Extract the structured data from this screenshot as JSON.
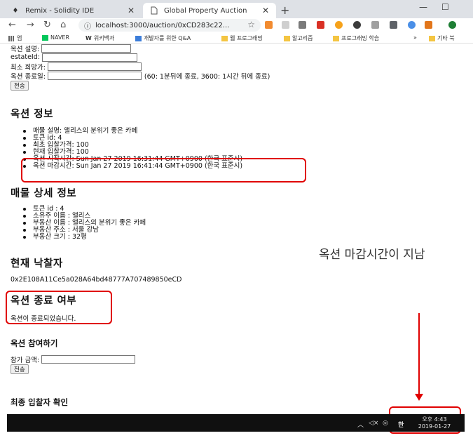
{
  "browser": {
    "tabs": [
      {
        "title": "Remix - Solidity IDE",
        "active": false
      },
      {
        "title": "Global Property Auction",
        "active": true
      }
    ],
    "address": {
      "url": "localhost:3000/auction/0xCD283c22..."
    },
    "bookmarks": [
      "앱",
      "NAVER",
      "위키백과",
      "개발자를 위한 Q&A",
      "웹 프로그래밍",
      "알고리즘",
      "프로그래밍 학습",
      "»",
      "기타 북"
    ],
    "colors": {
      "tabbar": "#dee1e6",
      "naver": "#03c75a"
    }
  },
  "form": {
    "description_label": "옥션 설명:",
    "estate_label": "estateId:",
    "min_price_label": "최소 희망가:",
    "end_label": "옥션 종료일:",
    "end_hint": "(60: 1분뒤에 종료, 3600: 1시간 뒤에 종료)",
    "submit": "전송"
  },
  "auction_info": {
    "heading": "옥션 정보",
    "items": [
      "매물 설명: 앨리스의 분위기 좋은 카페",
      "토큰 id: 4",
      "최초 입찰가격: 100",
      "현재 입찰가격: 100",
      "옥션 시작시간: Sun Jan 27 2019 16:31:44 GMT+0900 (한국 표준시)",
      "옥션 마감시간: Sun Jan 27 2019 16:41:44 GMT+0900 (한국 표준시)"
    ]
  },
  "property_info": {
    "heading": "매물 상세 정보",
    "items": [
      "토큰 id : 4",
      "소유주 이름 : 앨리스",
      "부동산 이름 : 앨리스의 분위기 좋은 카페",
      "부동산 주소 : 서울 강남",
      "부동산 크기 : 32평"
    ]
  },
  "winner": {
    "heading": "현재 낙찰자",
    "address": "0x2E108A11Ce5a028A64bd48777A707489850eCD"
  },
  "end_status": {
    "heading": "옥션 종료 여부",
    "text": "옥션이 종료되었습니다."
  },
  "join": {
    "heading": "옥션 참여하기",
    "amount_label": "참가 금액:",
    "submit": "전송"
  },
  "final": {
    "heading": "최종 입찰자 확인"
  },
  "annotation": {
    "text": "옥션 마감시간이 지남",
    "color": "#e00000"
  },
  "taskbar": {
    "time": "오후 4:43",
    "date": "2019-01-27",
    "ime": "한"
  }
}
